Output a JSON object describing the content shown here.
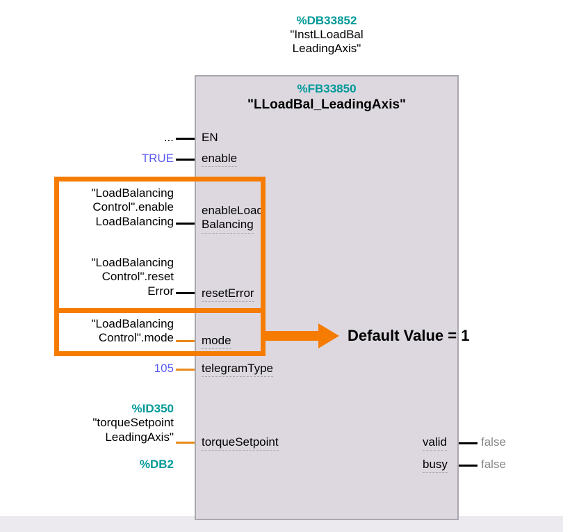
{
  "header": {
    "db_ref": "%DB33852",
    "instance_line1": "\"InstLLoadBal",
    "instance_line2": "LeadingAxis\""
  },
  "fb": {
    "fb_ref": "%FB33850",
    "title": "\"LLoadBal_LeadingAxis\""
  },
  "inputs": {
    "en": {
      "label": "EN",
      "value": "..."
    },
    "enable": {
      "label": "enable",
      "value": "TRUE"
    },
    "enableLoadBalancing": {
      "label_line1": "enableLoad",
      "label_line2": "Balancing",
      "value_line1": "\"LoadBalancing",
      "value_line2": "Control\".enable",
      "value_line3": "LoadBalancing"
    },
    "resetError": {
      "label": "resetError",
      "value_line1": "\"LoadBalancing",
      "value_line2": "Control\".reset",
      "value_line3": "Error"
    },
    "mode": {
      "label": "mode",
      "value_line1": "\"LoadBalancing",
      "value_line2": "Control\".mode"
    },
    "telegramType": {
      "label": "telegramType",
      "value": "105"
    },
    "torqueSetpoint": {
      "label": "torqueSetpoint",
      "id_ref": "%ID350",
      "value_line1": "\"torqueSetpoint",
      "value_line2": "LeadingAxis\""
    },
    "db2": "%DB2"
  },
  "outputs": {
    "valid": {
      "label": "valid",
      "value": "false"
    },
    "busy": {
      "label": "busy",
      "value": "false"
    }
  },
  "callout": "Default Value = 1"
}
